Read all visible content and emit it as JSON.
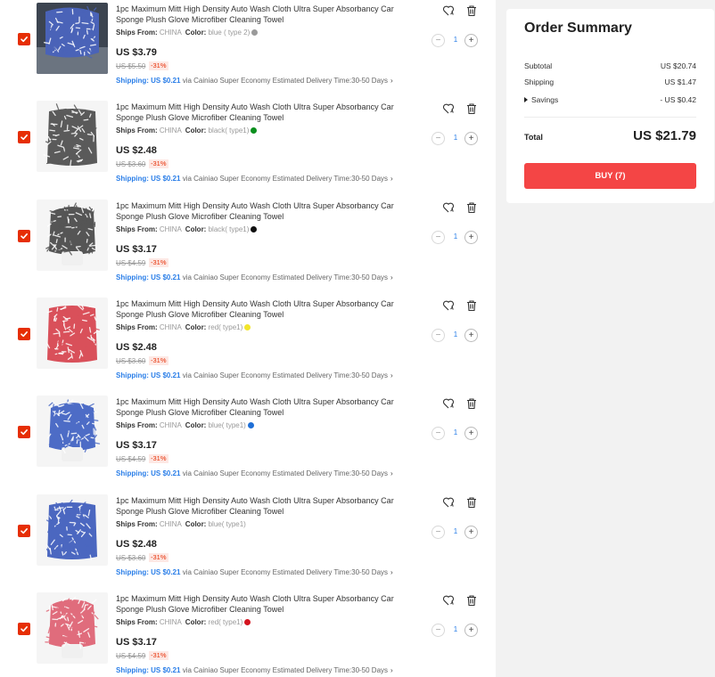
{
  "items": [
    {
      "title": "1pc Maximum Mitt High Density Auto Wash Cloth Ultra Super Absorbancy Car Sponge Plush Glove Microfiber Cleaning Towel",
      "ships_label": "Ships From:",
      "ships_value": "CHINA",
      "color_label": "Color:",
      "color_value": "blue ( type 2)",
      "color_dot": "#9a9a9a",
      "price": "US $3.79",
      "old_price": "US $5.50",
      "discount": "-31%",
      "shipping_label": "Shipping: US $0.21",
      "shipping_info": "via Cainiao Super Economy Estimated Delivery Time:30-50 Days",
      "qty": "1",
      "image": "blue-mitt-on-car",
      "image_color": "#4a63b8"
    },
    {
      "title": "1pc Maximum Mitt High Density Auto Wash Cloth Ultra Super Absorbancy Car Sponge Plush Glove Microfiber Cleaning Towel",
      "ships_label": "Ships From:",
      "ships_value": "CHINA",
      "color_label": "Color:",
      "color_value": "black( type1)",
      "color_dot": "#0b8f1e",
      "price": "US $2.48",
      "old_price": "US $3.60",
      "discount": "-31%",
      "shipping_label": "Shipping: US $0.21",
      "shipping_info": "via Cainiao Super Economy Estimated Delivery Time:30-50 Days",
      "qty": "1",
      "image": "black-cloth",
      "image_color": "#5a5a5a"
    },
    {
      "title": "1pc Maximum Mitt High Density Auto Wash Cloth Ultra Super Absorbancy Car Sponge Plush Glove Microfiber Cleaning Towel",
      "ships_label": "Ships From:",
      "ships_value": "CHINA",
      "color_label": "Color:",
      "color_value": "black( type1)",
      "color_dot": "#111111",
      "price": "US $3.17",
      "old_price": "US $4.59",
      "discount": "-31%",
      "shipping_label": "Shipping: US $0.21",
      "shipping_info": "via Cainiao Super Economy Estimated Delivery Time:30-50 Days",
      "qty": "1",
      "image": "black-mitt",
      "image_color": "#555555"
    },
    {
      "title": "1pc Maximum Mitt High Density Auto Wash Cloth Ultra Super Absorbancy Car Sponge Plush Glove Microfiber Cleaning Towel",
      "ships_label": "Ships From:",
      "ships_value": "CHINA",
      "color_label": "Color:",
      "color_value": "red( type1)",
      "color_dot": "#f2e52b",
      "price": "US $2.48",
      "old_price": "US $3.60",
      "discount": "-31%",
      "shipping_label": "Shipping: US $0.21",
      "shipping_info": "via Cainiao Super Economy Estimated Delivery Time:30-50 Days",
      "qty": "1",
      "image": "red-cloth",
      "image_color": "#d9505a"
    },
    {
      "title": "1pc Maximum Mitt High Density Auto Wash Cloth Ultra Super Absorbancy Car Sponge Plush Glove Microfiber Cleaning Towel",
      "ships_label": "Ships From:",
      "ships_value": "CHINA",
      "color_label": "Color:",
      "color_value": "blue( type1)",
      "color_dot": "#1f6fd6",
      "price": "US $3.17",
      "old_price": "US $4.59",
      "discount": "-31%",
      "shipping_label": "Shipping: US $0.21",
      "shipping_info": "via Cainiao Super Economy Estimated Delivery Time:30-50 Days",
      "qty": "1",
      "image": "blue-mitt",
      "image_color": "#4d6cc6"
    },
    {
      "title": "1pc Maximum Mitt High Density Auto Wash Cloth Ultra Super Absorbancy Car Sponge Plush Glove Microfiber Cleaning Towel",
      "ships_label": "Ships From:",
      "ships_value": "CHINA",
      "color_label": "Color:",
      "color_value": "blue( type1)",
      "color_dot": "#ffffff",
      "price": "US $2.48",
      "old_price": "US $3.60",
      "discount": "-31%",
      "shipping_label": "Shipping: US $0.21",
      "shipping_info": "via Cainiao Super Economy Estimated Delivery Time:30-50 Days",
      "qty": "1",
      "image": "blue-cloth",
      "image_color": "#4b67c0"
    },
    {
      "title": "1pc Maximum Mitt High Density Auto Wash Cloth Ultra Super Absorbancy Car Sponge Plush Glove Microfiber Cleaning Towel",
      "ships_label": "Ships From:",
      "ships_value": "CHINA",
      "color_label": "Color:",
      "color_value": "red( type1)",
      "color_dot": "#d4141f",
      "price": "US $3.17",
      "old_price": "US $4.59",
      "discount": "-31%",
      "shipping_label": "Shipping: US $0.21",
      "shipping_info": "via Cainiao Super Economy Estimated Delivery Time:30-50 Days",
      "qty": "1",
      "image": "red-mitt",
      "image_color": "#e06c7c"
    }
  ],
  "icons": {
    "wishlist": "heart-refresh-icon",
    "delete": "trash-icon",
    "minus": "minus-icon",
    "plus": "plus-icon",
    "checkbox": "check-icon",
    "expand": "caret-right-icon"
  },
  "summary": {
    "title": "Order Summary",
    "subtotal_label": "Subtotal",
    "subtotal_value": "US $20.74",
    "shipping_label": "Shipping",
    "shipping_value": "US $1.47",
    "savings_label": "Savings",
    "savings_value": "- US $0.42",
    "total_label": "Total",
    "total_value": "US $21.79",
    "buy_label": "BUY (7)"
  },
  "colors": {
    "accent_red": "#f44545",
    "check_red": "#e62e04",
    "link_blue": "#2a7ee8",
    "background": "#f2f2f2"
  }
}
